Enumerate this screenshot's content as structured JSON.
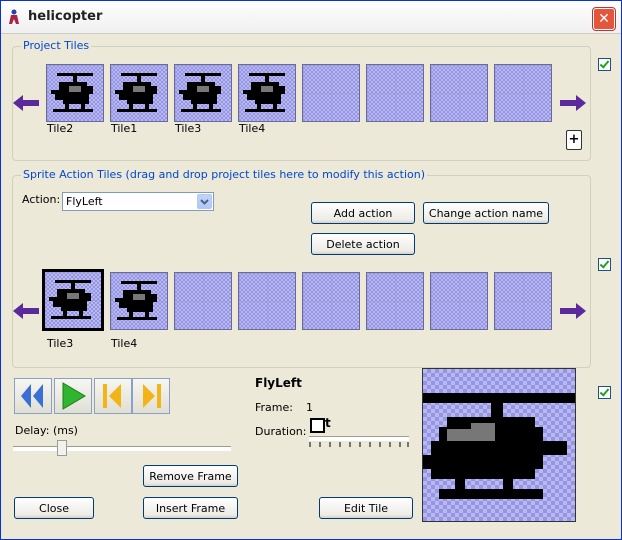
{
  "window": {
    "title": "helicopter",
    "close_glyph": "✕"
  },
  "project_tiles": {
    "label": "Project Tiles",
    "tile_labels": [
      "Tile2",
      "Tile1",
      "Tile3",
      "Tile4"
    ],
    "add_glyph": "+"
  },
  "action_tiles": {
    "label": "Sprite Action Tiles (drag and drop project tiles here to modify this action)",
    "action_label": "Action:",
    "action_value": "FlyLeft",
    "add_action": "Add action",
    "change_action_name": "Change action name",
    "delete_action": "Delete action",
    "tile_labels": [
      "Tile3",
      "Tile4"
    ]
  },
  "playback": {
    "delay_label": "Delay: (ms)",
    "remove_frame": "Remove Frame",
    "insert_frame": "Insert Frame",
    "close": "Close"
  },
  "frame_info": {
    "action_name": "FlyLeft",
    "frame_label": "Frame:",
    "frame_value": "1",
    "duration_label": "Duration:",
    "duration_value": "t",
    "edit_tile": "Edit Tile"
  },
  "colors": {
    "accent_arrow": "#5a2a9a",
    "group_label": "#0046d5",
    "tile_bg": "#b9b9f0"
  }
}
